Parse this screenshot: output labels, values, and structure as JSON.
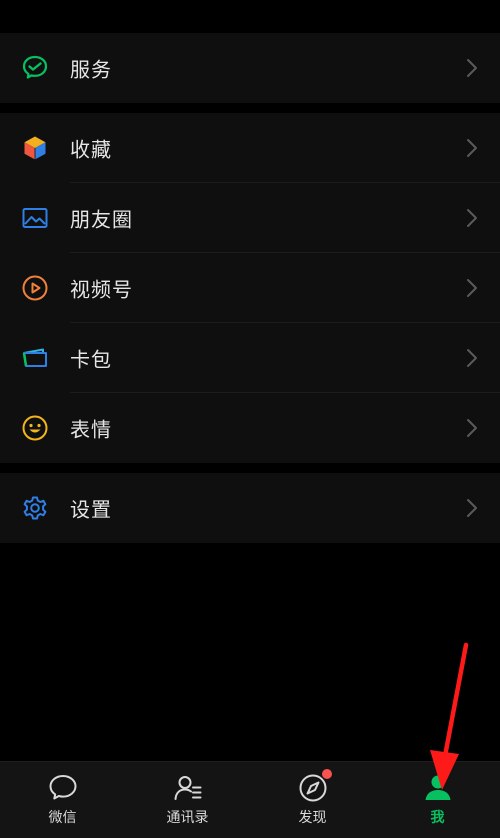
{
  "menu": {
    "services": {
      "label": "服务",
      "icon": "wechat-pay-icon",
      "color": "#07c160"
    },
    "favorites": {
      "label": "收藏",
      "icon": "cube-icon"
    },
    "moments": {
      "label": "朋友圈",
      "icon": "image-icon",
      "color": "#2f7fe6"
    },
    "channels": {
      "label": "视频号",
      "icon": "play-circle-icon",
      "color": "#f0803c"
    },
    "cards": {
      "label": "卡包",
      "icon": "wallet-icon",
      "color": "#2f7fe6"
    },
    "stickers": {
      "label": "表情",
      "icon": "smiley-icon",
      "color": "#f2b61b"
    },
    "settings": {
      "label": "设置",
      "icon": "gear-icon",
      "color": "#2f7fe6"
    }
  },
  "tabbar": {
    "chats": {
      "label": "微信",
      "icon": "chat-bubble-icon"
    },
    "contacts": {
      "label": "通讯录",
      "icon": "contacts-icon"
    },
    "discover": {
      "label": "发现",
      "icon": "compass-icon",
      "badge": "dot"
    },
    "me": {
      "label": "我",
      "icon": "person-icon",
      "active": true
    }
  },
  "colors": {
    "background": "#000000",
    "card": "#0f0f0f",
    "text": "#e6e6e6",
    "accent_green": "#07c160",
    "annotation_red": "#ff1a1a"
  }
}
